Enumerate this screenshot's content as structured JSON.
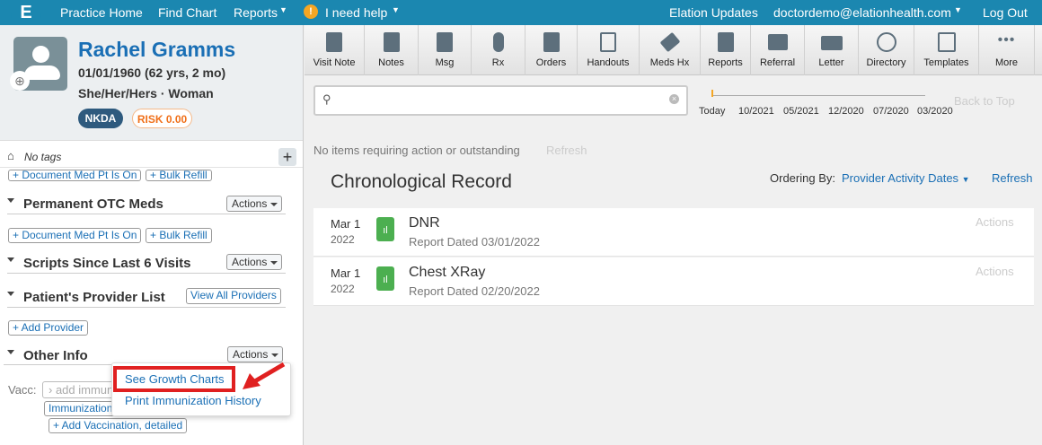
{
  "topbar": {
    "nav": [
      "Practice Home",
      "Find Chart",
      "Reports",
      "I need help"
    ],
    "right": [
      "Elation Updates",
      "doctordemo@elationhealth.com",
      "Log Out"
    ],
    "logo": "E"
  },
  "patient": {
    "name": "Rachel Gramms",
    "dob": "01/01/1960 (62 yrs, 2 mo)",
    "identity": "She/Her/Hers · Woman",
    "allergy_badge": "NKDA",
    "risk_badge": "RISK 0.00",
    "tags": "No tags"
  },
  "sidebar": {
    "doc_med": "+ Document Med Pt Is On",
    "bulk_refill": "+ Bulk Refill",
    "sections": [
      {
        "title": "Permanent OTC Meds",
        "action": "Actions"
      },
      {
        "title": "Scripts Since Last 6 Visits",
        "action": "Actions"
      },
      {
        "title": "Patient's Provider List",
        "action": "View All Providers"
      },
      {
        "title": "Other Info",
        "action": "Actions"
      }
    ],
    "add_provider": "+ Add Provider",
    "vacc_label": "Vacc:",
    "vacc_placeholder": "add immunization",
    "immunization_btn": "Immunization",
    "add_vacc": "+ Add Vaccination, detailed"
  },
  "dropdown": {
    "items": [
      "See Growth Charts",
      "Print Immunization History"
    ],
    "highlight_color": "#e02020"
  },
  "toolbar": [
    "Visit Note",
    "Notes",
    "Msg",
    "Rx",
    "Orders",
    "Handouts",
    "Meds Hx",
    "Reports",
    "Referral",
    "Letter",
    "Directory",
    "Templates",
    "More"
  ],
  "timeline": {
    "labels": [
      "Today",
      "10/2021",
      "05/2021",
      "12/2020",
      "07/2020",
      "03/2020"
    ],
    "back_to_top": "Back to Top"
  },
  "main": {
    "no_items": "No items requiring action or outstanding",
    "refresh_muted": "Refresh",
    "title": "Chronological Record",
    "ordering_label": "Ordering By:",
    "ordering_value": "Provider Activity Dates",
    "refresh": "Refresh",
    "records": [
      {
        "month": "Mar 1",
        "year": "2022",
        "title": "DNR",
        "sub": "Report Dated 03/01/2022",
        "action": "Actions"
      },
      {
        "month": "Mar 1",
        "year": "2022",
        "title": "Chest XRay",
        "sub": "Report Dated 02/20/2022",
        "action": "Actions"
      }
    ]
  }
}
